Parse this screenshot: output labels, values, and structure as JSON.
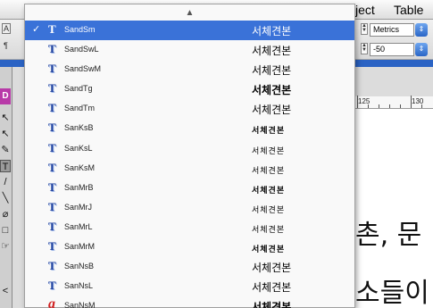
{
  "menubar": {
    "items": [
      {
        "label": "ject"
      },
      {
        "label": "Table"
      }
    ]
  },
  "toolbar": {
    "tracking_label": "Metrics",
    "kerning_value": "-50",
    "panel_letter_a": "A",
    "paragraph_glyph": "¶"
  },
  "ruler": {
    "labels": [
      "125",
      "130"
    ]
  },
  "toolbox": {
    "swatch_letter": "D",
    "tools": [
      "↖",
      "↖",
      "✎",
      "T",
      "/",
      "╲",
      "⌀",
      "□",
      "☞",
      "<"
    ]
  },
  "canvas": {
    "line1": "촌, 문",
    "line2": "소들이"
  },
  "font_menu": {
    "scroll_up_icon": "triangle-up-icon",
    "items": [
      {
        "name": "SandSm",
        "sample": "서체견본",
        "icon": "T",
        "selected": true,
        "style": "normal"
      },
      {
        "name": "SandSwL",
        "sample": "서체견본",
        "icon": "T",
        "selected": false,
        "style": "normal"
      },
      {
        "name": "SandSwM",
        "sample": "서체견본",
        "icon": "T",
        "selected": false,
        "style": "normal"
      },
      {
        "name": "SandTg",
        "sample": "서체견본",
        "icon": "T",
        "selected": false,
        "style": "bold"
      },
      {
        "name": "SandTm",
        "sample": "서체견본",
        "icon": "T",
        "selected": false,
        "style": "normal"
      },
      {
        "name": "SanKsB",
        "sample": "서체견본",
        "icon": "T",
        "selected": false,
        "style": "brush"
      },
      {
        "name": "SanKsL",
        "sample": "서체견본",
        "icon": "T",
        "selected": false,
        "style": "brush-light"
      },
      {
        "name": "SanKsM",
        "sample": "서체견본",
        "icon": "T",
        "selected": false,
        "style": "brush-light"
      },
      {
        "name": "SanMrB",
        "sample": "서체견본",
        "icon": "T",
        "selected": false,
        "style": "brush"
      },
      {
        "name": "SanMrJ",
        "sample": "서체견본",
        "icon": "T",
        "selected": false,
        "style": "brush-light"
      },
      {
        "name": "SanMrL",
        "sample": "서체견본",
        "icon": "T",
        "selected": false,
        "style": "brush-light"
      },
      {
        "name": "SanMrM",
        "sample": "서체견본",
        "icon": "T",
        "selected": false,
        "style": "brush"
      },
      {
        "name": "SanNsB",
        "sample": "서체견본",
        "icon": "T",
        "selected": false,
        "style": "normal"
      },
      {
        "name": "SanNsL",
        "sample": "서체견본",
        "icon": "T",
        "selected": false,
        "style": "normal"
      },
      {
        "name": "SanNsM",
        "sample": "서체견본",
        "icon": "a",
        "selected": false,
        "style": "bold"
      }
    ]
  },
  "colors": {
    "selection": "#3a72d8",
    "truetype_icon": "#1c3f9e",
    "opentype_icon": "#d12020"
  }
}
